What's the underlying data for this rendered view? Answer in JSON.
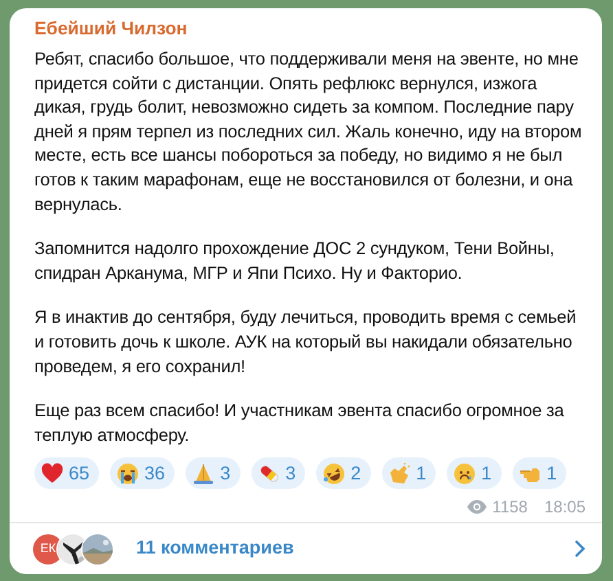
{
  "post": {
    "author": "Ебейший Чилзон",
    "paragraphs": [
      "Ребят, спасибо большое, что поддерживали меня на эвенте, но мне придется сойти с дистанции. Опять рефлюкс вернулся, изжога дикая, грудь болит, невозможно сидеть за компом. Последние пару дней я прям терпел из последних сил. Жаль конечно, иду на втором месте, есть все шансы побороться за победу, но видимо я не был готов к таким марафонам, еще не восстановился от болезни, и она вернулась.",
      "Запомнится надолго прохождение ДОС 2 сундуком, Тени Войны, спидран Арканума, МГР и Япи Психо. Ну и Факторио.",
      "Я в инактив до сентября, буду лечиться, проводить время с семьей и готовить дочь к школе. АУК на который вы накидали обязательно проведем, я его сохранил!",
      "Еще раз всем спасибо! И участникам эвента спасибо огромное за теплую атмосферу."
    ],
    "reactions": [
      {
        "kind": "heart",
        "count": "65"
      },
      {
        "kind": "sob",
        "count": "36"
      },
      {
        "kind": "pray",
        "count": "3"
      },
      {
        "kind": "pill",
        "count": "3"
      },
      {
        "kind": "rofl",
        "count": "2"
      },
      {
        "kind": "clap",
        "count": "1"
      },
      {
        "kind": "cry",
        "count": "1"
      },
      {
        "kind": "point",
        "count": "1"
      }
    ],
    "views": "1158",
    "time": "18:05"
  },
  "comments": {
    "avatars": [
      {
        "kind": "initials",
        "text": "ЕК"
      },
      {
        "kind": "picture"
      },
      {
        "kind": "picture"
      }
    ],
    "label": "11 комментариев"
  }
}
